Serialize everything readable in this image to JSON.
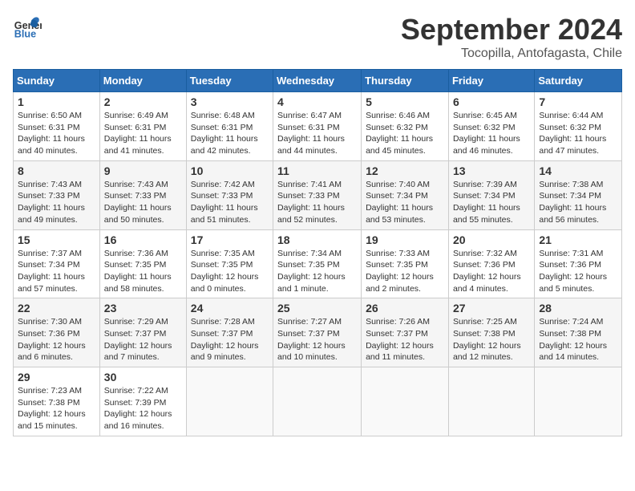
{
  "header": {
    "logo_general": "General",
    "logo_blue": "Blue",
    "month": "September 2024",
    "location": "Tocopilla, Antofagasta, Chile"
  },
  "weekdays": [
    "Sunday",
    "Monday",
    "Tuesday",
    "Wednesday",
    "Thursday",
    "Friday",
    "Saturday"
  ],
  "weeks": [
    [
      {
        "day": 1,
        "sunrise": "6:50 AM",
        "sunset": "6:31 PM",
        "daylight": "11 hours and 40 minutes."
      },
      {
        "day": 2,
        "sunrise": "6:49 AM",
        "sunset": "6:31 PM",
        "daylight": "11 hours and 41 minutes."
      },
      {
        "day": 3,
        "sunrise": "6:48 AM",
        "sunset": "6:31 PM",
        "daylight": "11 hours and 42 minutes."
      },
      {
        "day": 4,
        "sunrise": "6:47 AM",
        "sunset": "6:31 PM",
        "daylight": "11 hours and 44 minutes."
      },
      {
        "day": 5,
        "sunrise": "6:46 AM",
        "sunset": "6:32 PM",
        "daylight": "11 hours and 45 minutes."
      },
      {
        "day": 6,
        "sunrise": "6:45 AM",
        "sunset": "6:32 PM",
        "daylight": "11 hours and 46 minutes."
      },
      {
        "day": 7,
        "sunrise": "6:44 AM",
        "sunset": "6:32 PM",
        "daylight": "11 hours and 47 minutes."
      }
    ],
    [
      {
        "day": 8,
        "sunrise": "7:43 AM",
        "sunset": "7:33 PM",
        "daylight": "11 hours and 49 minutes."
      },
      {
        "day": 9,
        "sunrise": "7:43 AM",
        "sunset": "7:33 PM",
        "daylight": "11 hours and 50 minutes."
      },
      {
        "day": 10,
        "sunrise": "7:42 AM",
        "sunset": "7:33 PM",
        "daylight": "11 hours and 51 minutes."
      },
      {
        "day": 11,
        "sunrise": "7:41 AM",
        "sunset": "7:33 PM",
        "daylight": "11 hours and 52 minutes."
      },
      {
        "day": 12,
        "sunrise": "7:40 AM",
        "sunset": "7:34 PM",
        "daylight": "11 hours and 53 minutes."
      },
      {
        "day": 13,
        "sunrise": "7:39 AM",
        "sunset": "7:34 PM",
        "daylight": "11 hours and 55 minutes."
      },
      {
        "day": 14,
        "sunrise": "7:38 AM",
        "sunset": "7:34 PM",
        "daylight": "11 hours and 56 minutes."
      }
    ],
    [
      {
        "day": 15,
        "sunrise": "7:37 AM",
        "sunset": "7:34 PM",
        "daylight": "11 hours and 57 minutes."
      },
      {
        "day": 16,
        "sunrise": "7:36 AM",
        "sunset": "7:35 PM",
        "daylight": "11 hours and 58 minutes."
      },
      {
        "day": 17,
        "sunrise": "7:35 AM",
        "sunset": "7:35 PM",
        "daylight": "12 hours and 0 minutes."
      },
      {
        "day": 18,
        "sunrise": "7:34 AM",
        "sunset": "7:35 PM",
        "daylight": "12 hours and 1 minute."
      },
      {
        "day": 19,
        "sunrise": "7:33 AM",
        "sunset": "7:35 PM",
        "daylight": "12 hours and 2 minutes."
      },
      {
        "day": 20,
        "sunrise": "7:32 AM",
        "sunset": "7:36 PM",
        "daylight": "12 hours and 4 minutes."
      },
      {
        "day": 21,
        "sunrise": "7:31 AM",
        "sunset": "7:36 PM",
        "daylight": "12 hours and 5 minutes."
      }
    ],
    [
      {
        "day": 22,
        "sunrise": "7:30 AM",
        "sunset": "7:36 PM",
        "daylight": "12 hours and 6 minutes."
      },
      {
        "day": 23,
        "sunrise": "7:29 AM",
        "sunset": "7:37 PM",
        "daylight": "12 hours and 7 minutes."
      },
      {
        "day": 24,
        "sunrise": "7:28 AM",
        "sunset": "7:37 PM",
        "daylight": "12 hours and 9 minutes."
      },
      {
        "day": 25,
        "sunrise": "7:27 AM",
        "sunset": "7:37 PM",
        "daylight": "12 hours and 10 minutes."
      },
      {
        "day": 26,
        "sunrise": "7:26 AM",
        "sunset": "7:37 PM",
        "daylight": "12 hours and 11 minutes."
      },
      {
        "day": 27,
        "sunrise": "7:25 AM",
        "sunset": "7:38 PM",
        "daylight": "12 hours and 12 minutes."
      },
      {
        "day": 28,
        "sunrise": "7:24 AM",
        "sunset": "7:38 PM",
        "daylight": "12 hours and 14 minutes."
      }
    ],
    [
      {
        "day": 29,
        "sunrise": "7:23 AM",
        "sunset": "7:38 PM",
        "daylight": "12 hours and 15 minutes."
      },
      {
        "day": 30,
        "sunrise": "7:22 AM",
        "sunset": "7:39 PM",
        "daylight": "12 hours and 16 minutes."
      },
      null,
      null,
      null,
      null,
      null
    ]
  ]
}
